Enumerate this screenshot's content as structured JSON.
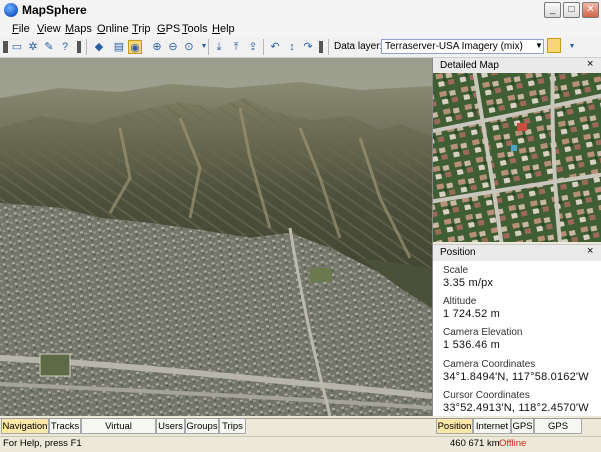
{
  "window": {
    "title": "MapSphere"
  },
  "menu": [
    "File",
    "View",
    "Maps",
    "Online",
    "Trip",
    "GPS",
    "Tools",
    "Help"
  ],
  "toolbar": {
    "icons": [
      "open-folder-icon",
      "settings-icon",
      "pencil-icon",
      "help-icon",
      "cube-icon",
      "layers-icon",
      "globe-icon",
      "zoom-in-icon",
      "zoom-out-icon",
      "zoom-icon",
      "download-icon",
      "upload-icon",
      "upload-all-icon",
      "rotate-left-icon",
      "tilt-icon",
      "rotate-right-icon"
    ],
    "data_layer_label": "Data layer:",
    "data_layer_value": "Terraserver-USA Imagery (mix)"
  },
  "detail_panel": {
    "title": "Detailed Map",
    "close": "×"
  },
  "position_panel": {
    "title": "Position",
    "close": "×",
    "fields": [
      {
        "label": "Scale",
        "value": "3.35 m/px"
      },
      {
        "label": "Altitude",
        "value": "1 724.52 m"
      },
      {
        "label": "Camera Elevation",
        "value": "1 536.46 m"
      },
      {
        "label": "Camera Coordinates",
        "value": "34°1.8494'N, 117°58.0162'W"
      },
      {
        "label": "Cursor Coordinates",
        "value": "33°52.4913'N, 118°2.4570'W"
      }
    ]
  },
  "left_tabs": [
    "Navigation",
    "Tracks",
    "Virtual Geocaching",
    "Users",
    "Groups",
    "Trips"
  ],
  "right_tabs": [
    "Position",
    "Internet",
    "GPS",
    "GPS Status"
  ],
  "status": {
    "help": "For Help, press F1",
    "memory": "460 671 km",
    "connection": "Offline"
  },
  "colors": {
    "offline": "#d12a1f",
    "active_tab": "#fbe7a8"
  }
}
